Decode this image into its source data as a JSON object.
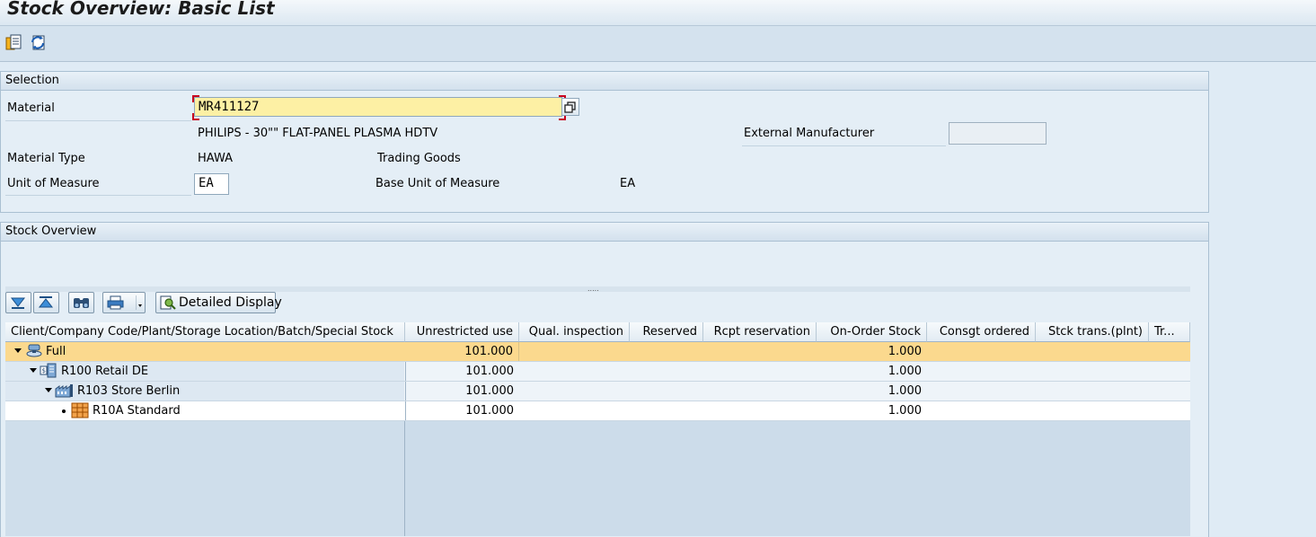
{
  "window": {
    "title": "Stock Overview: Basic List"
  },
  "toolbar": {
    "icons": [
      "select-layout-icon",
      "refresh-icon"
    ]
  },
  "selection": {
    "header": "Selection",
    "material_label": "Material",
    "material_value": "MR411127",
    "material_description": "PHILIPS - 30\"\" FLAT-PANEL PLASMA HDTV",
    "ext_manufacturer_label": "External Manufacturer",
    "ext_manufacturer_value": "",
    "material_type_label": "Material Type",
    "material_type_value": "HAWA",
    "material_type_desc": "Trading Goods",
    "uom_label": "Unit of Measure",
    "uom_value": "EA",
    "base_uom_label": "Base Unit of Measure",
    "base_uom_value": "EA"
  },
  "stock_overview": {
    "header": "Stock Overview",
    "detailed_display_label": "Detailed Display",
    "columns": [
      "Client/Company Code/Plant/Storage Location/Batch/Special Stock",
      "Unrestricted use",
      "Qual. inspection",
      "Reserved",
      "Rcpt reservation",
      "On-Order Stock",
      "Consgt ordered",
      "Stck trans.(plnt)",
      "Tr..."
    ],
    "rows": [
      {
        "label": "Full",
        "unrestricted": "101.000",
        "on_order": "1.000",
        "icon": "client-icon"
      },
      {
        "label": "R100 Retail DE",
        "unrestricted": "101.000",
        "on_order": "1.000",
        "icon": "company-code-icon"
      },
      {
        "label": "R103 Store Berlin",
        "unrestricted": "101.000",
        "on_order": "1.000",
        "icon": "plant-icon"
      },
      {
        "label": "R10A Standard",
        "unrestricted": "101.000",
        "on_order": "1.000",
        "icon": "storage-location-icon"
      }
    ]
  },
  "colors": {
    "background": "#dfebf5",
    "selected_row": "#fbd98e",
    "input_active": "#fdf0a4"
  }
}
